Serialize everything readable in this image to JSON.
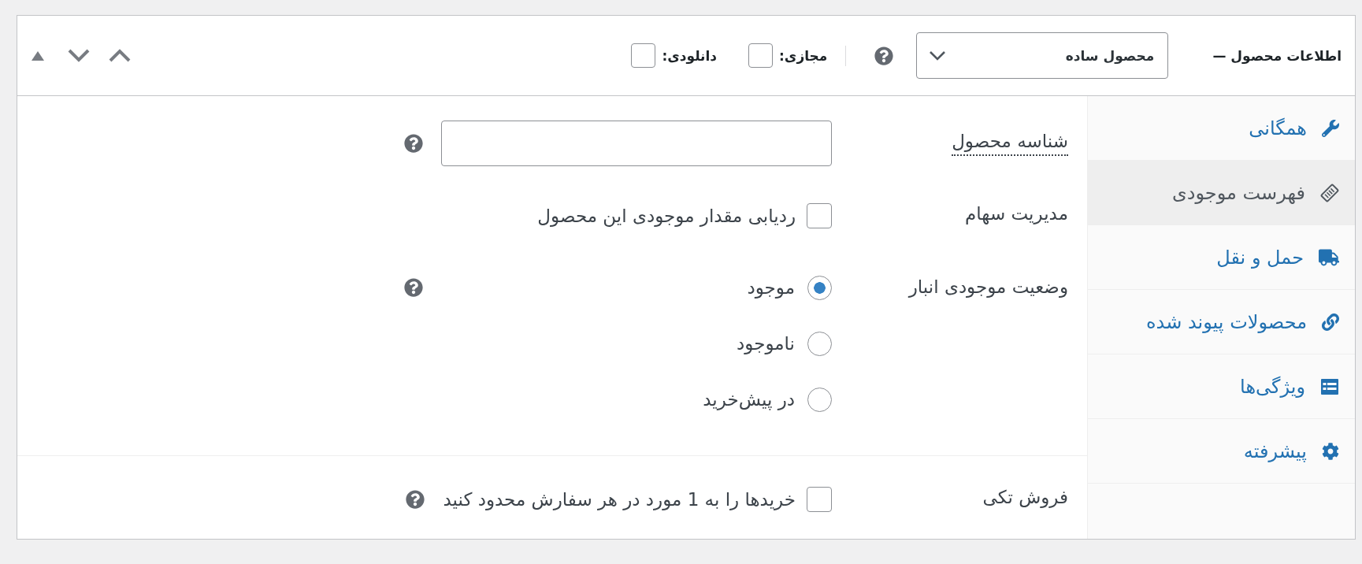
{
  "header": {
    "title": "اطلاعات محصول —",
    "product_type": "محصول ساده",
    "help": true,
    "options": [
      {
        "label": "مجازی:",
        "checked": false
      },
      {
        "label": "دانلودی:",
        "checked": false
      }
    ]
  },
  "sidebar": {
    "items": [
      {
        "label": "همگانی",
        "selected": false
      },
      {
        "label": "فهرست موجودی",
        "selected": true
      },
      {
        "label": "حمل و نقل",
        "selected": false
      },
      {
        "label": "محصولات پیوند شده",
        "selected": false
      },
      {
        "label": "ویژگی‌ها",
        "selected": false
      },
      {
        "label": "پیشرفته",
        "selected": false
      }
    ]
  },
  "sections": [
    {
      "fields": [
        {
          "kind": "text",
          "label": "شناسه محصول",
          "abbr": true,
          "help": true
        },
        {
          "kind": "checkbox",
          "label": "مدیریت سهام",
          "option": {
            "label": "ردیابی مقدار موجودی این محصول",
            "checked": false
          }
        },
        {
          "kind": "radio",
          "label": "وضعیت موجودی انبار",
          "help": true,
          "options": [
            {
              "label": "موجود",
              "selected": true
            },
            {
              "label": "ناموجود",
              "selected": false
            },
            {
              "label": "در پیش‌خرید",
              "selected": false
            }
          ]
        }
      ]
    },
    {
      "fields": [
        {
          "kind": "checkbox",
          "label": "فروش تکی",
          "help": true,
          "option": {
            "label": "خریدها را به 1 مورد در هر سفارش محدود کنید",
            "checked": false
          }
        }
      ]
    }
  ]
}
